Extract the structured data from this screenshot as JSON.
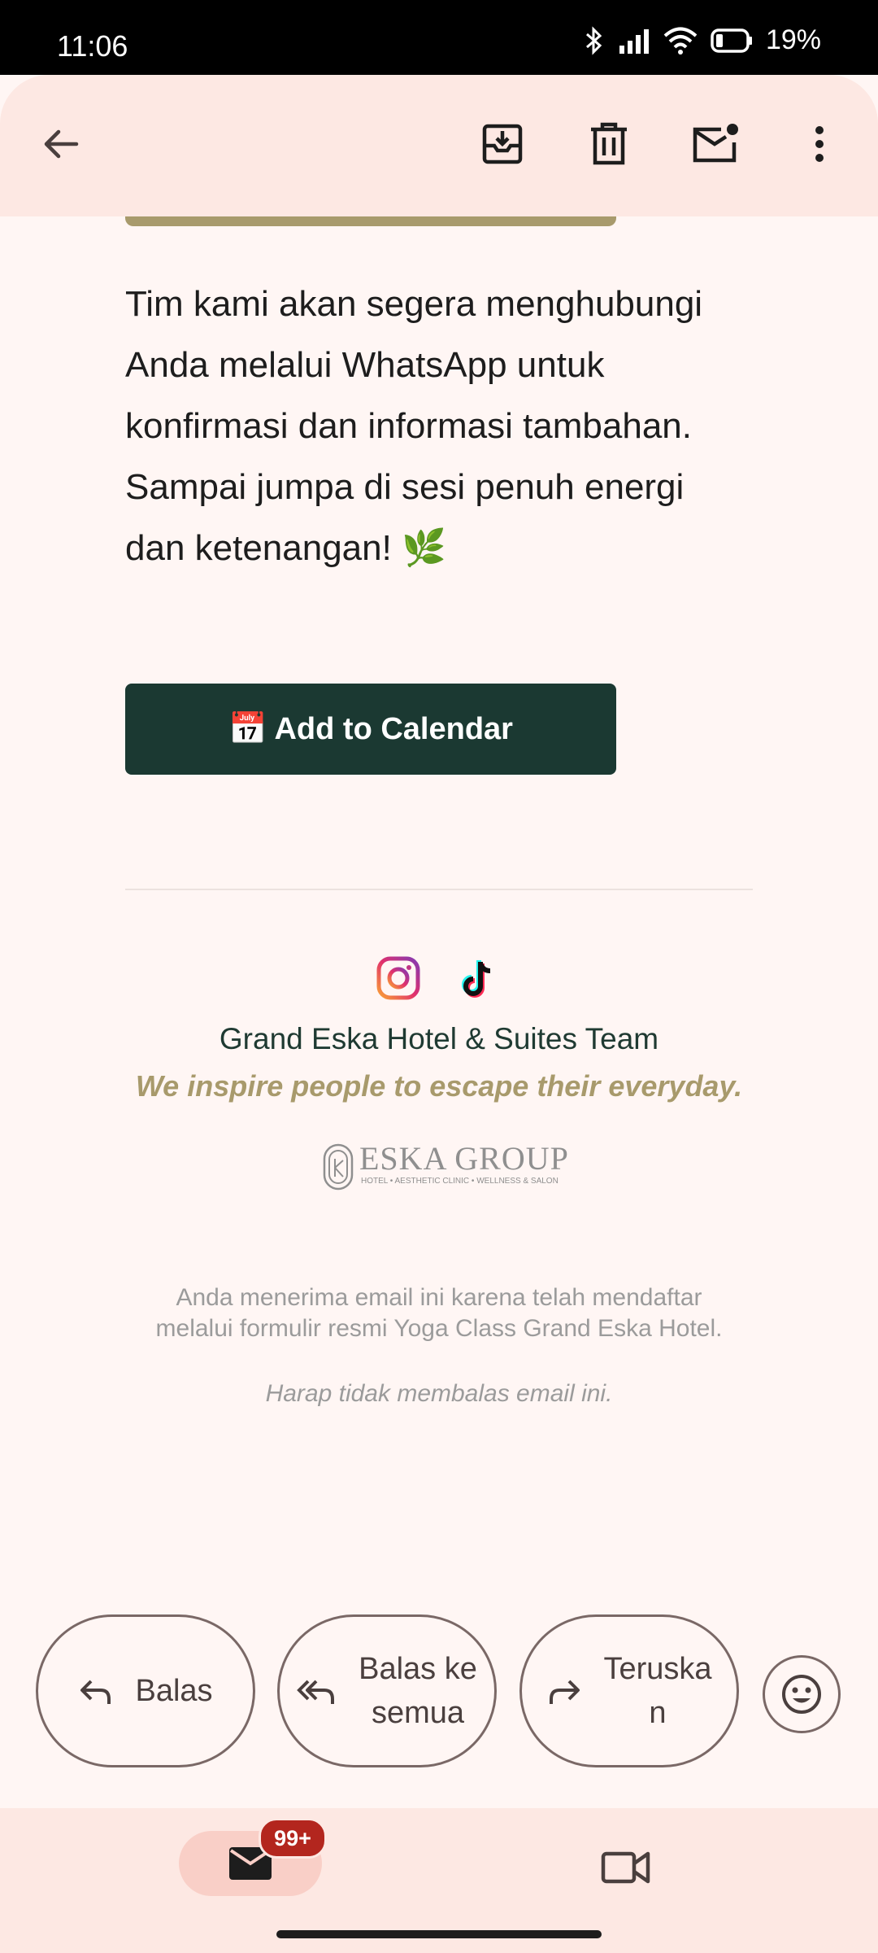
{
  "status_bar": {
    "time": "11:06",
    "battery": "19%"
  },
  "top_bar": {
    "back_icon": "arrow-back-icon",
    "archive_icon": "archive-icon",
    "delete_icon": "trash-icon",
    "mark_unread_icon": "mail-unread-icon",
    "more_icon": "more-vert-icon"
  },
  "email": {
    "body_lines": [
      "Tim kami akan segera menghubungi",
      "Anda melalui WhatsApp untuk",
      "konfirmasi dan informasi tambahan.",
      "Sampai jumpa di sesi penuh energi",
      "dan ketenangan! 🌿"
    ],
    "calendar_button": "📅 Add to Calendar",
    "team_name": "Grand Eska Hotel & Suites Team",
    "tagline": "We inspire people to escape their everyday.",
    "logo": {
      "name": "ESKA GROUP",
      "subtitle": "HOTEL • AESTHETIC CLINIC • WELLNESS & SALON"
    },
    "footer_lines": [
      "Anda menerima email ini karena telah mendaftar",
      "melalui formulir resmi Yoga Class Grand Eska Hotel."
    ],
    "no_reply": "Harap tidak membalas email ini."
  },
  "actions": {
    "reply": "Balas",
    "reply_all_line1": "Balas ke",
    "reply_all_line2": "semua",
    "forward_line1": "Teruska",
    "forward_line2": "n"
  },
  "bottom_nav": {
    "mail_badge": "99+"
  },
  "colors": {
    "accent_dark": "#1b3932",
    "gold": "#a89a6c",
    "badge": "#b3261e"
  }
}
